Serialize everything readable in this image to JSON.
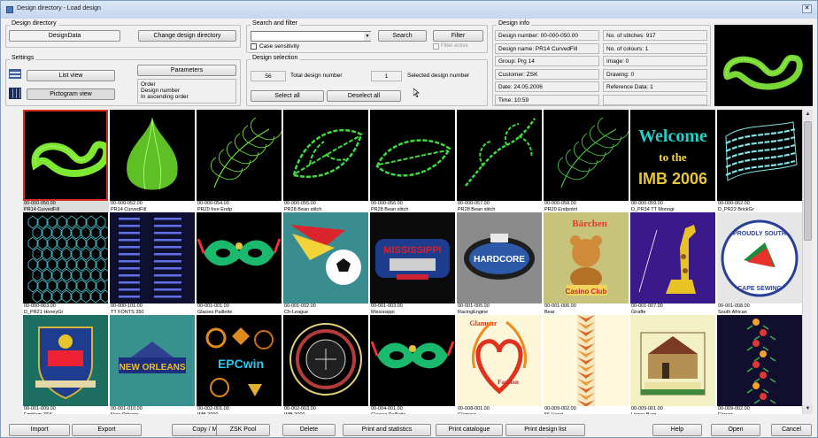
{
  "window": {
    "title": "Design directory  -  Load design",
    "close_label": "✕"
  },
  "design_directory": {
    "group_label": "Design directory",
    "current": "DesignData",
    "change_button": "Change design directory"
  },
  "settings": {
    "group_label": "Settings",
    "list_view": "List view",
    "pictogram_view": "Pictogram view",
    "parameters": "Parameters",
    "order_lines": [
      "Order",
      "Design number",
      "In ascending order"
    ]
  },
  "search": {
    "group_label": "Search and filter",
    "input_value": "",
    "search_button": "Search",
    "filter_button": "Filter",
    "case_sensitivity": "Case sensitivity",
    "filter_active": "Filter active"
  },
  "selection": {
    "group_label": "Design selection",
    "total_count": "56",
    "total_label": "Total design number",
    "selected_count": "1",
    "selected_label": "Selected design number",
    "select_all": "Select all",
    "deselect_all": "Deselect all"
  },
  "design_info": {
    "group_label": "Design info",
    "left": [
      "Design number: 00-000-050.00",
      "Design name: PR14 CurvedFill",
      "Group: Prg 14",
      "Customer: ZSK",
      "Date: 24.05.2006",
      "Time: 10:59"
    ],
    "right": [
      "No. of stitches: 917",
      "No. of colours: 1",
      "Image: 0",
      "Drawing: 0",
      "Reference Data: 1"
    ]
  },
  "designs": [
    {
      "number": "00-000-050.00",
      "name": "PR14 CurvedFill",
      "bg": "#000000",
      "art": "curved",
      "fg": "#7de832",
      "selected": true
    },
    {
      "number": "00-000-052.00",
      "name": "PR14 CurvedFill",
      "bg": "#000000",
      "art": "onion",
      "fg": "#6fe22b"
    },
    {
      "number": "00-000-054.00",
      "name": "PR20 free Endp",
      "bg": "#000000",
      "art": "feather",
      "fg": "#71da3a"
    },
    {
      "number": "00-000-055.00",
      "name": "PR28 Bean stitch",
      "bg": "#000000",
      "art": "leaf",
      "fg": "#3fdc3f"
    },
    {
      "number": "00-000-056.00",
      "name": "PR28 Bean stitch",
      "bg": "#000000",
      "art": "leaf2",
      "fg": "#3fdc3f"
    },
    {
      "number": "00-000-057.00",
      "name": "PR28 Bean stitch",
      "bg": "#000000",
      "art": "vine",
      "fg": "#3fdc3f"
    },
    {
      "number": "00-000-058.00",
      "name": "PR20 Endpoint",
      "bg": "#000000",
      "art": "feather",
      "fg": "#4bbf47"
    },
    {
      "number": "00-000-059.00",
      "name": "D_PR34 TT Monogr",
      "bg": "#000000",
      "art": "welcome",
      "fg": "#22d0c8",
      "text": [
        "Welcome",
        "to the",
        "IMB 2006"
      ]
    },
    {
      "number": "00-000-062.00",
      "name": "D_PR22 BrickGr",
      "bg": "#000000",
      "art": "brick",
      "fg": "#7fe3e8"
    },
    {
      "number": "00-000-063.00",
      "name": "D_PR21 HoneyGr",
      "bg": "#000000",
      "art": "honey",
      "fg": "#4fd3e0"
    },
    {
      "number": "00-000-101.00",
      "name": "TT FONTS 350",
      "bg": "#0f1030",
      "art": "fonts",
      "fg": "#6270e6"
    },
    {
      "number": "00-001-001.00",
      "name": "Glacies Paillette",
      "bg": "#000000",
      "art": "mask",
      "fg": "#1ab96e"
    },
    {
      "number": "00-001-002.00",
      "name": "Ch-League",
      "bg": "#3a8d8e",
      "art": "soccer",
      "fg": "#d9252b"
    },
    {
      "number": "00-001-003.00",
      "name": "Mississippi",
      "bg": "#0b0b0b",
      "art": "mississippi",
      "fg": "#d8202a",
      "text": [
        "MISSISSIPPI"
      ]
    },
    {
      "number": "00-001-005.00",
      "name": "RacingEngine",
      "bg": "#8b8b8b",
      "art": "hardcore",
      "fg": "#2c5aa8",
      "text": [
        "HARDCORE"
      ]
    },
    {
      "number": "00-001-006.00",
      "name": "Bear",
      "bg": "#c8c37a",
      "art": "bear",
      "fg": "#e36d1c",
      "text": [
        "Bärchen",
        "Casino Club"
      ]
    },
    {
      "number": "00-001-007.00",
      "name": "Giraffe",
      "bg": "#3a1a8a",
      "art": "giraffe",
      "fg": "#e9c324"
    },
    {
      "number": "00-001-008.00",
      "name": "South African",
      "bg": "#e6e6e6",
      "art": "southafrica",
      "fg": "#2a3f99",
      "text": [
        "PROUDLY SOUTH",
        "CAPE SEWING"
      ]
    },
    {
      "number": "00-001-009.00",
      "name": "Emblem ZSK",
      "bg": "#1d6f62",
      "art": "emblem",
      "fg": "#1f3d8f"
    },
    {
      "number": "00-001-010.00",
      "name": "New Orleans",
      "bg": "#36918f",
      "art": "neworleans",
      "fg": "#f2bf2a",
      "text": [
        "NEW ORLEANS"
      ]
    },
    {
      "number": "00-002-001.00",
      "name": "IMB 2000",
      "bg": "#000000",
      "art": "epc",
      "fg": "#e08a1d",
      "text": [
        "EPCwin"
      ]
    },
    {
      "number": "00-002-003.00",
      "name": "IMB 2000",
      "bg": "#000000",
      "art": "zsk",
      "fg": "#b43b3b"
    },
    {
      "number": "00-004-001.00",
      "name": "Glacies Paillette",
      "bg": "#000000",
      "art": "mask",
      "fg": "#1ab96e"
    },
    {
      "number": "00-008-001.00",
      "name": "Glamour",
      "bg": "#fdf6d8",
      "art": "glamour",
      "fg": "#e0321c",
      "text": [
        "Glamour",
        "Fashion"
      ]
    },
    {
      "number": "00-009-002.00",
      "name": "56 Head",
      "bg": "#fff8dc",
      "art": "strip",
      "fg": "#e69c3a"
    },
    {
      "number": "00-009-001.00",
      "name": "Linner Burg",
      "bg": "#f3f0c4",
      "art": "burg",
      "fg": "#7a5a2a"
    },
    {
      "number": "00-009-002.00",
      "name": "Flower",
      "bg": "#120f2e",
      "art": "flower",
      "fg": "#e33636"
    }
  ],
  "bottom_buttons": [
    "Import",
    "Export",
    "Copy / Move",
    "ZSK Pool",
    "Delete",
    "Print and statistics",
    "Print catalogue",
    "Print design list",
    "Help",
    "Open",
    "Cancel"
  ],
  "scrollbar": {
    "up": "▲",
    "down": "▼"
  }
}
